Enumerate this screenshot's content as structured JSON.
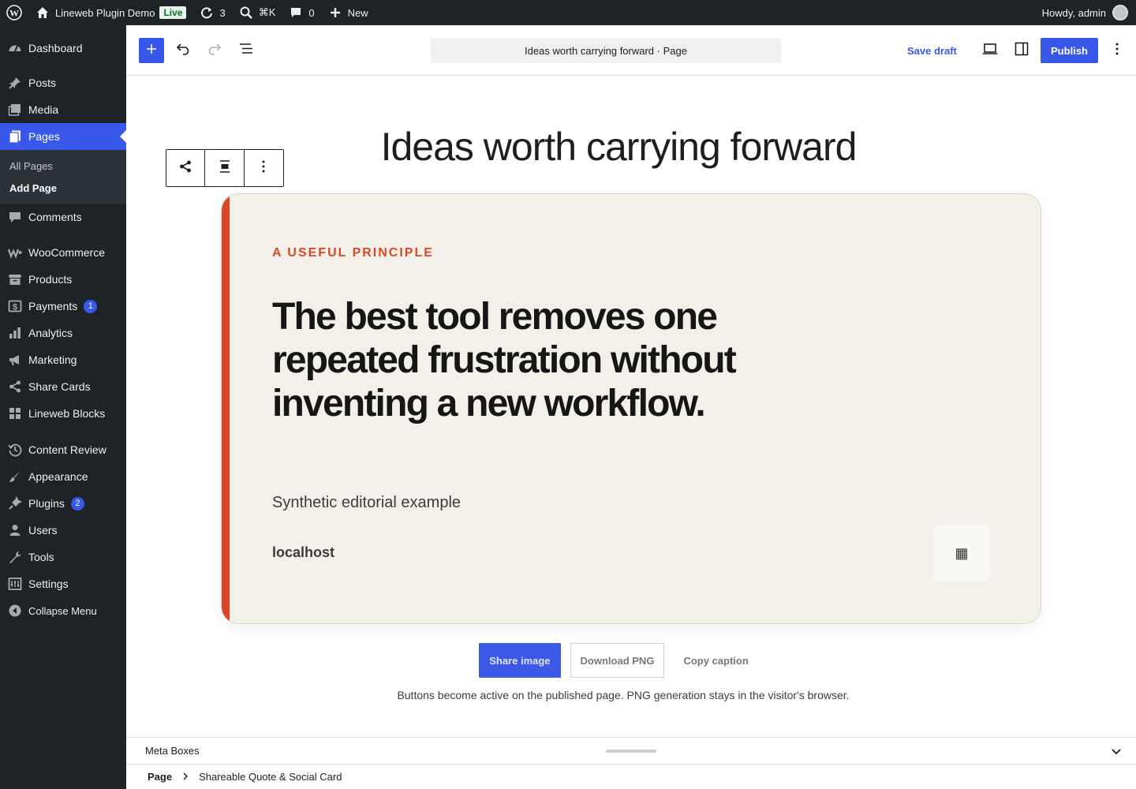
{
  "admin_bar": {
    "site_name": "Lineweb Plugin Demo",
    "live_badge": "Live",
    "updates_count": "3",
    "search_shortcut": "⌘K",
    "comments_count": "0",
    "new_label": "New",
    "greeting": "Howdy, admin"
  },
  "sidebar": {
    "items": [
      {
        "label": "Dashboard",
        "icon": "dashboard-icon"
      },
      {
        "label": "Posts",
        "icon": "pin-icon"
      },
      {
        "label": "Media",
        "icon": "media-icon"
      },
      {
        "label": "Pages",
        "icon": "pages-icon"
      },
      {
        "label": "Comments",
        "icon": "comment-icon"
      },
      {
        "label": "WooCommerce",
        "icon": "woocommerce-icon"
      },
      {
        "label": "Products",
        "icon": "archive-icon"
      },
      {
        "label": "Payments",
        "icon": "payments-icon",
        "badge": "1"
      },
      {
        "label": "Analytics",
        "icon": "bar-chart-icon"
      },
      {
        "label": "Marketing",
        "icon": "megaphone-icon"
      },
      {
        "label": "Share Cards",
        "icon": "share-icon"
      },
      {
        "label": "Lineweb Blocks",
        "icon": "grid-icon"
      },
      {
        "label": "Content Review",
        "icon": "history-icon"
      },
      {
        "label": "Appearance",
        "icon": "brush-icon"
      },
      {
        "label": "Plugins",
        "icon": "plug-icon",
        "badge": "2"
      },
      {
        "label": "Users",
        "icon": "user-icon"
      },
      {
        "label": "Tools",
        "icon": "wrench-icon"
      },
      {
        "label": "Settings",
        "icon": "sliders-icon"
      },
      {
        "label": "Collapse Menu",
        "icon": "collapse-icon"
      }
    ],
    "pages_submenu": [
      "All Pages",
      "Add Page"
    ]
  },
  "editor": {
    "document_title": "Ideas worth carrying forward · Page",
    "save_draft": "Save draft",
    "publish": "Publish"
  },
  "content": {
    "page_title": "Ideas worth carrying forward",
    "card": {
      "eyebrow": "A USEFUL PRINCIPLE",
      "quote": "The best tool removes one repeated frustration without inventing a new workflow.",
      "attribution": "Synthetic editorial example",
      "domain": "localhost",
      "qr_glyph": "▦"
    },
    "actions": {
      "share_image": "Share image",
      "download_png": "Download PNG",
      "copy_caption": "Copy caption"
    },
    "note": "Buttons become active on the published page. PNG generation stays in the visitor's browser."
  },
  "footer": {
    "meta_boxes": "Meta Boxes",
    "breadcrumb_root": "Page",
    "breadcrumb_current": "Shareable Quote & Social Card"
  },
  "colors": {
    "accent": "#3858e9",
    "card_accent": "#d9472b",
    "card_bg": "#f3efe9",
    "admin_dark": "#1d2327"
  }
}
